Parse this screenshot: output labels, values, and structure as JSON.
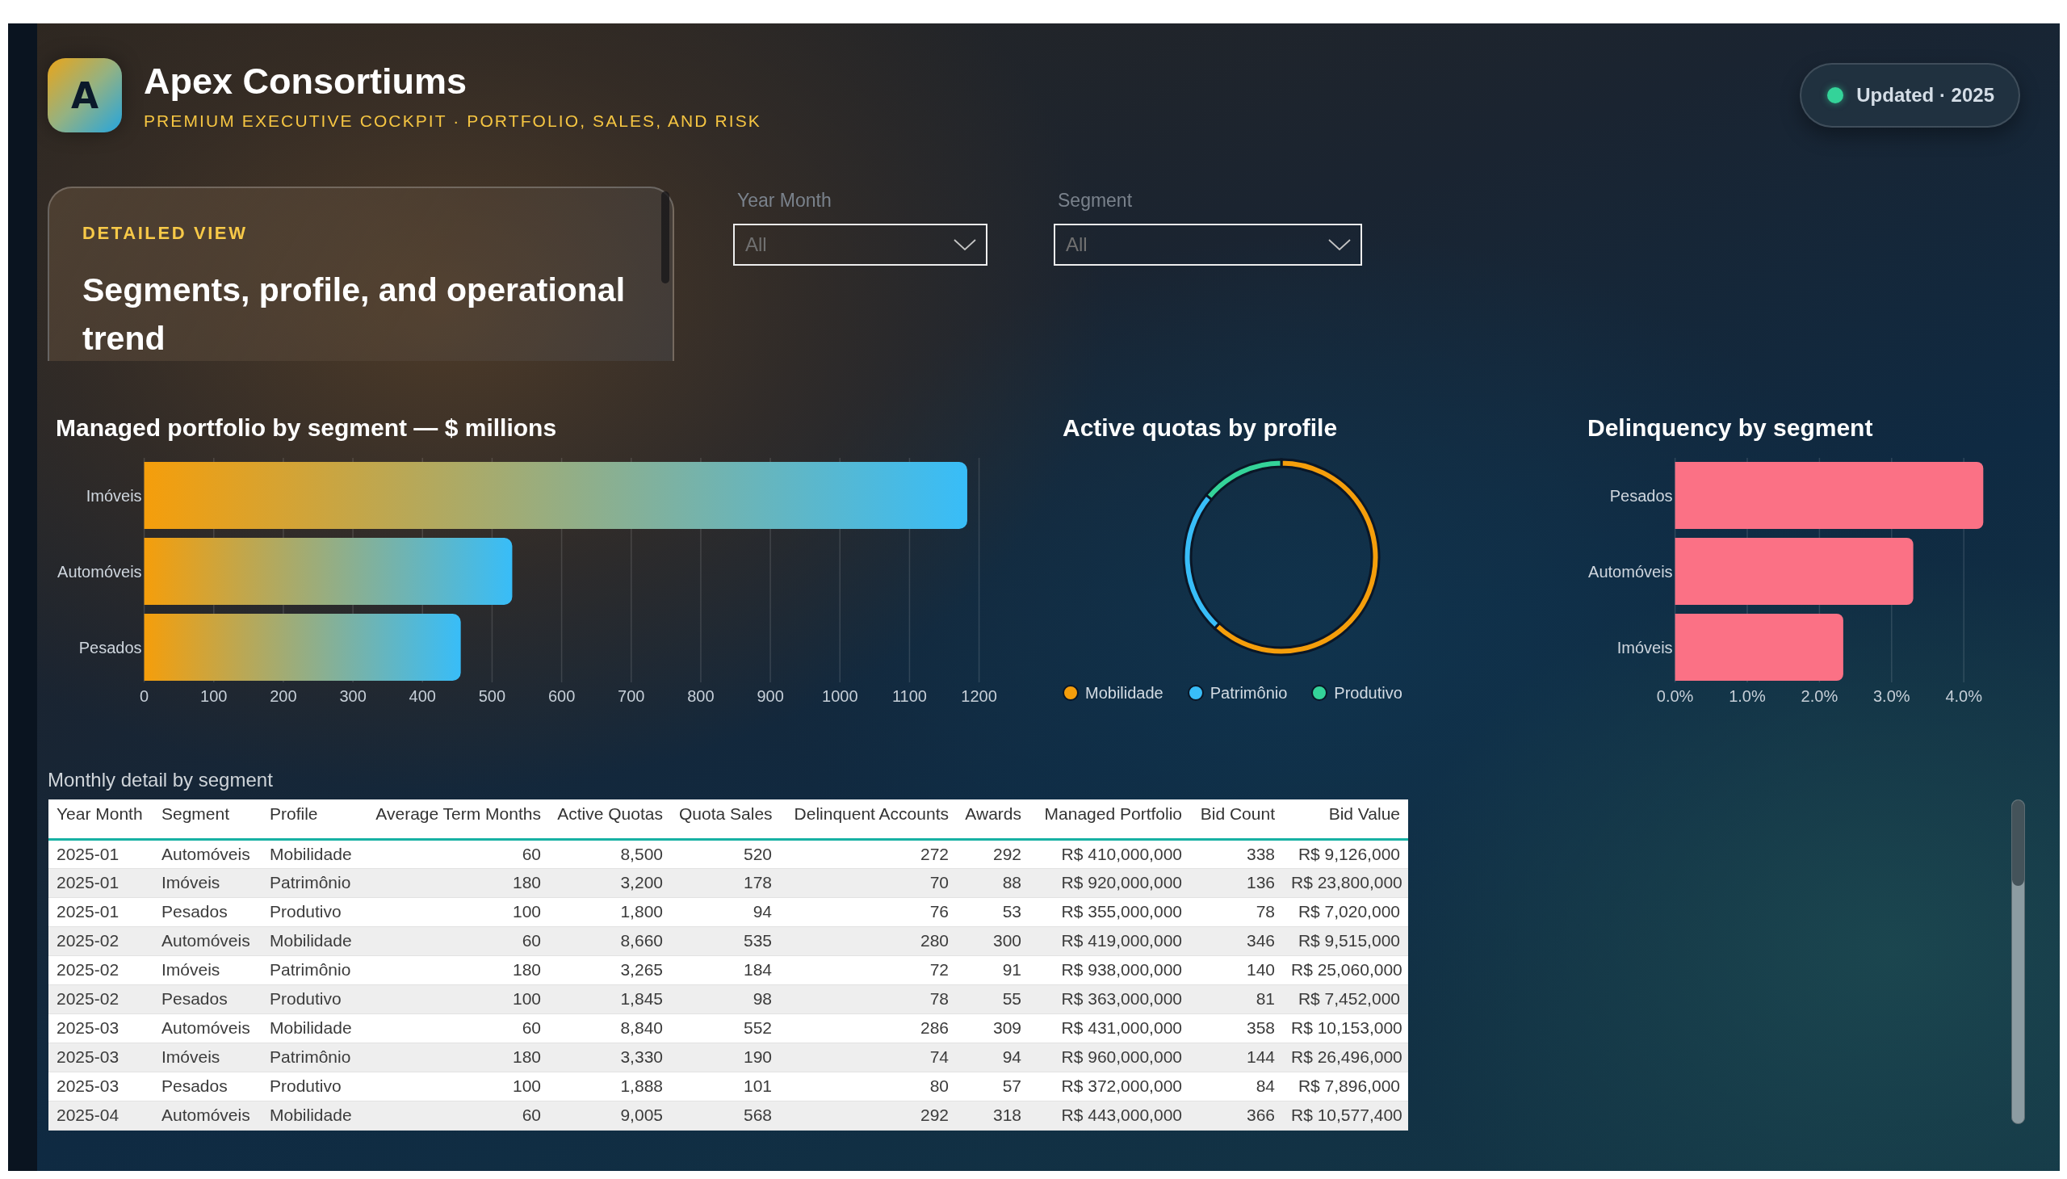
{
  "header": {
    "logo_text": "A",
    "title": "Apex Consortiums",
    "subtitle": "PREMIUM EXECUTIVE COCKPIT · PORTFOLIO, SALES, AND RISK",
    "status": "Updated · 2025"
  },
  "detail_card": {
    "eyebrow": "DETAILED VIEW",
    "heading": "Segments, profile, and operational trend"
  },
  "filters": [
    {
      "label": "Year Month",
      "value": "All"
    },
    {
      "label": "Segment",
      "value": "All"
    }
  ],
  "charts": [
    {
      "kind": "gradient",
      "title": "Managed portfolio by segment — $ millions",
      "chart_data": {
        "type": "bar",
        "orientation": "horizontal",
        "categories": [
          "Imóveis",
          "Automóveis",
          "Pesados"
        ],
        "values": [
          1183,
          529,
          455
        ],
        "xlim": [
          0,
          1200
        ],
        "xticks": [
          0,
          100,
          200,
          300,
          400,
          500,
          600,
          700,
          800,
          900,
          1000,
          1100,
          1200
        ],
        "grid": true
      }
    },
    {
      "kind": "ring",
      "title": "Active quotas by profile",
      "chart_data": {
        "type": "donut",
        "categories": [
          "Mobilidade",
          "Patrimônio",
          "Produtivo"
        ],
        "values": [
          62,
          24,
          14
        ],
        "legend": "bottom"
      },
      "slices": [
        {
          "color": "#f59e0b"
        },
        {
          "color": "#38bdf8"
        },
        {
          "color": "#34d399"
        }
      ]
    },
    {
      "kind": "solid",
      "title": "Delinquency by segment",
      "chart_data": {
        "type": "bar",
        "orientation": "horizontal",
        "categories": [
          "Pesados",
          "Automóveis",
          "Imóveis"
        ],
        "values": [
          4.27,
          3.3,
          2.33
        ],
        "xlim": [
          0,
          4.3
        ],
        "xticks": [
          {
            "value": 0,
            "label": "0.0%"
          },
          {
            "value": 1,
            "label": "1.0%"
          },
          {
            "value": 2,
            "label": "2.0%"
          },
          {
            "value": 3,
            "label": "3.0%"
          },
          {
            "value": 4,
            "label": "4.0%"
          }
        ],
        "grid": true
      }
    }
  ],
  "table": {
    "title": "Monthly detail by segment",
    "columns": [
      {
        "label": "Year Month",
        "kind": "text"
      },
      {
        "label": "Segment",
        "kind": "text"
      },
      {
        "label": "Profile",
        "kind": "text"
      },
      {
        "label": "Average Term Months",
        "kind": "number"
      },
      {
        "label": "Active Quotas",
        "kind": "number"
      },
      {
        "label": "Quota Sales",
        "kind": "number"
      },
      {
        "label": "Delinquent Accounts",
        "kind": "number"
      },
      {
        "label": "Awards",
        "kind": "number"
      },
      {
        "label": "Managed Portfolio",
        "kind": "number"
      },
      {
        "label": "Bid Count",
        "kind": "number"
      },
      {
        "label": "Bid Value",
        "kind": "number"
      }
    ],
    "rows": [
      [
        "2025-01",
        "Automóveis",
        "Mobilidade",
        "60",
        "8,500",
        "520",
        "272",
        "292",
        "R$ 410,000,000",
        "338",
        "R$ 9,126,000"
      ],
      [
        "2025-01",
        "Imóveis",
        "Patrimônio",
        "180",
        "3,200",
        "178",
        "70",
        "88",
        "R$ 920,000,000",
        "136",
        "R$ 23,800,000"
      ],
      [
        "2025-01",
        "Pesados",
        "Produtivo",
        "100",
        "1,800",
        "94",
        "76",
        "53",
        "R$ 355,000,000",
        "78",
        "R$ 7,020,000"
      ],
      [
        "2025-02",
        "Automóveis",
        "Mobilidade",
        "60",
        "8,660",
        "535",
        "280",
        "300",
        "R$ 419,000,000",
        "346",
        "R$ 9,515,000"
      ],
      [
        "2025-02",
        "Imóveis",
        "Patrimônio",
        "180",
        "3,265",
        "184",
        "72",
        "91",
        "R$ 938,000,000",
        "140",
        "R$ 25,060,000"
      ],
      [
        "2025-02",
        "Pesados",
        "Produtivo",
        "100",
        "1,845",
        "98",
        "78",
        "55",
        "R$ 363,000,000",
        "81",
        "R$ 7,452,000"
      ],
      [
        "2025-03",
        "Automóveis",
        "Mobilidade",
        "60",
        "8,840",
        "552",
        "286",
        "309",
        "R$ 431,000,000",
        "358",
        "R$ 10,153,000"
      ],
      [
        "2025-03",
        "Imóveis",
        "Patrimônio",
        "180",
        "3,330",
        "190",
        "74",
        "94",
        "R$ 960,000,000",
        "144",
        "R$ 26,496,000"
      ],
      [
        "2025-03",
        "Pesados",
        "Produtivo",
        "100",
        "1,888",
        "101",
        "80",
        "57",
        "R$ 372,000,000",
        "84",
        "R$ 7,896,000"
      ],
      [
        "2025-04",
        "Automóveis",
        "Mobilidade",
        "60",
        "9,005",
        "568",
        "292",
        "318",
        "R$ 443,000,000",
        "366",
        "R$ 10,577,400"
      ]
    ]
  }
}
